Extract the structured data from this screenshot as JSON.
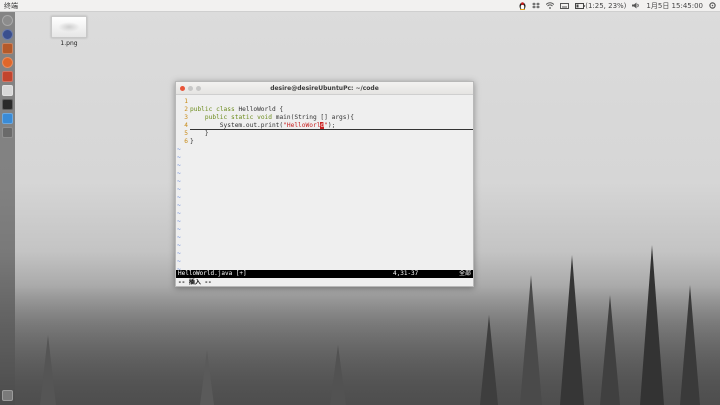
{
  "top_panel": {
    "app_title": "终端",
    "battery_text": "(1:25, 23%)",
    "datetime": "1月5日 15:45:00"
  },
  "launcher": {
    "items": [
      {
        "name": "dash-home",
        "color": "#8c8c8c"
      },
      {
        "name": "browser",
        "color": "#3a4f8e"
      },
      {
        "name": "files",
        "color": "#b45a2a"
      },
      {
        "name": "firefox",
        "color": "#e0672a"
      },
      {
        "name": "software-center",
        "color": "#c2452e"
      },
      {
        "name": "tool",
        "color": "#d8d8d8"
      },
      {
        "name": "terminal",
        "color": "#2a2a2a"
      },
      {
        "name": "app-blue",
        "color": "#3a8bd6"
      },
      {
        "name": "system-settings",
        "color": "#6a6a6a"
      },
      {
        "name": "trash",
        "color": "#7a7a7a"
      }
    ]
  },
  "desktop": {
    "file_label": "1.png"
  },
  "terminal": {
    "title": "desire@desireUbuntuPc: ~/code",
    "lines": [
      {
        "num": "1",
        "code": ""
      },
      {
        "num": "2",
        "code": "public class HelloWorld {"
      },
      {
        "num": "3",
        "code": "    public static void main(String [] args){"
      },
      {
        "num": "4",
        "code": "        System.out.print(\"HelloWorld\");"
      },
      {
        "num": "5",
        "code": "    }"
      },
      {
        "num": "6",
        "code": "}"
      }
    ],
    "tilde_lines": 16,
    "status": {
      "file": "HelloWorld.java [+]",
      "position": "4,31-37",
      "scroll": "全部"
    },
    "mode": "-- 插入 --"
  }
}
